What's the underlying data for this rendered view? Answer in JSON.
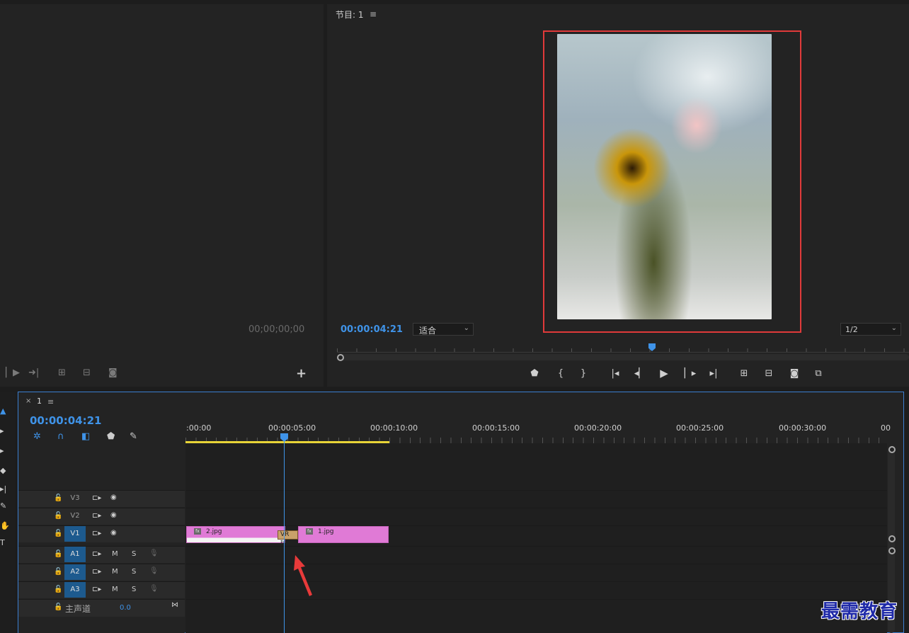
{
  "source_monitor": {
    "timecode": "00;00;00;00",
    "controls": [
      "step-forward-icon",
      "go-to-out-icon",
      "insert-icon",
      "overwrite-icon",
      "camera-icon"
    ],
    "add_label": "+"
  },
  "program_monitor": {
    "title": "节目: 1",
    "menu_icon": "≡",
    "timecode": "00:00:04:21",
    "zoom": "适合",
    "resolution": "1/2",
    "controls": [
      "marker-icon",
      "mark-in-icon",
      "mark-out-icon",
      "go-to-in-icon",
      "step-back-icon",
      "play-icon",
      "step-forward-icon",
      "go-to-out-icon",
      "lift-icon",
      "extract-icon",
      "camera-icon",
      "compare-icon"
    ],
    "playhead_fraction": 0.55
  },
  "timeline": {
    "close": "×",
    "sequence_name": "1",
    "menu_icon": "≡",
    "timecode": "00:00:04:21",
    "ruler_labels": [
      ":00:00",
      "00:00:05:00",
      "00:00:10:00",
      "00:00:15:00",
      "00:00:20:00",
      "00:00:25:00",
      "00:00:30:00",
      "00"
    ],
    "tracks": {
      "v3": "V3",
      "v2": "V2",
      "v1": "V1",
      "a1": "A1",
      "a2": "A2",
      "a3": "A3"
    },
    "mute": "M",
    "solo": "S",
    "master_label": "主声道",
    "master_volume": "0.0",
    "clips": {
      "clip1": "2.jpg",
      "clip2": "1.jpg",
      "transition": "VR 球"
    }
  },
  "watermark": "最需教育",
  "colors": {
    "accent": "#3f93e8",
    "clip": "#e07ad6",
    "highlight_frame": "#e03a3a",
    "work_area": "#e8d437"
  }
}
